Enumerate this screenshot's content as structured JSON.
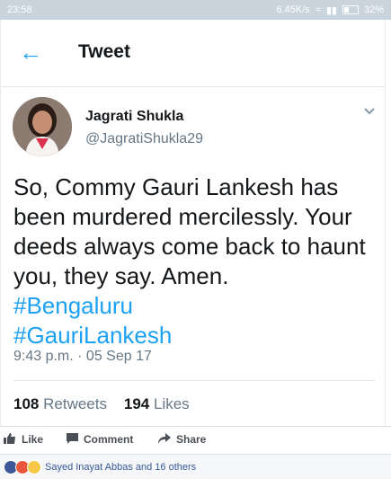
{
  "status_bar": {
    "time": "23:58",
    "speed": "6.45K/s",
    "battery": "32%"
  },
  "header": {
    "title": "Tweet"
  },
  "tweet": {
    "name": "Jagrati Shukla",
    "handle": "@JagratiShukla29",
    "text_line": "So, Commy Gauri Lankesh has been murdered mercilessly. Your deeds always come back to haunt you, they say. Amen.",
    "hashtags": [
      "#Bengaluru",
      "#GauriLankesh"
    ],
    "timestamp": "9:43 p.m. · 05 Sep 17",
    "retweets_count": "108",
    "retweets_label": "Retweets",
    "likes_count": "194",
    "likes_label": "Likes"
  },
  "facebook": {
    "like_label": "Like",
    "comment_label": "Comment",
    "share_label": "Share",
    "reactions_text": "Sayed Inayat Abbas and 16 others"
  },
  "colors": {
    "accent": "#1da1f2",
    "text": "#14171a",
    "muted": "#657786"
  }
}
